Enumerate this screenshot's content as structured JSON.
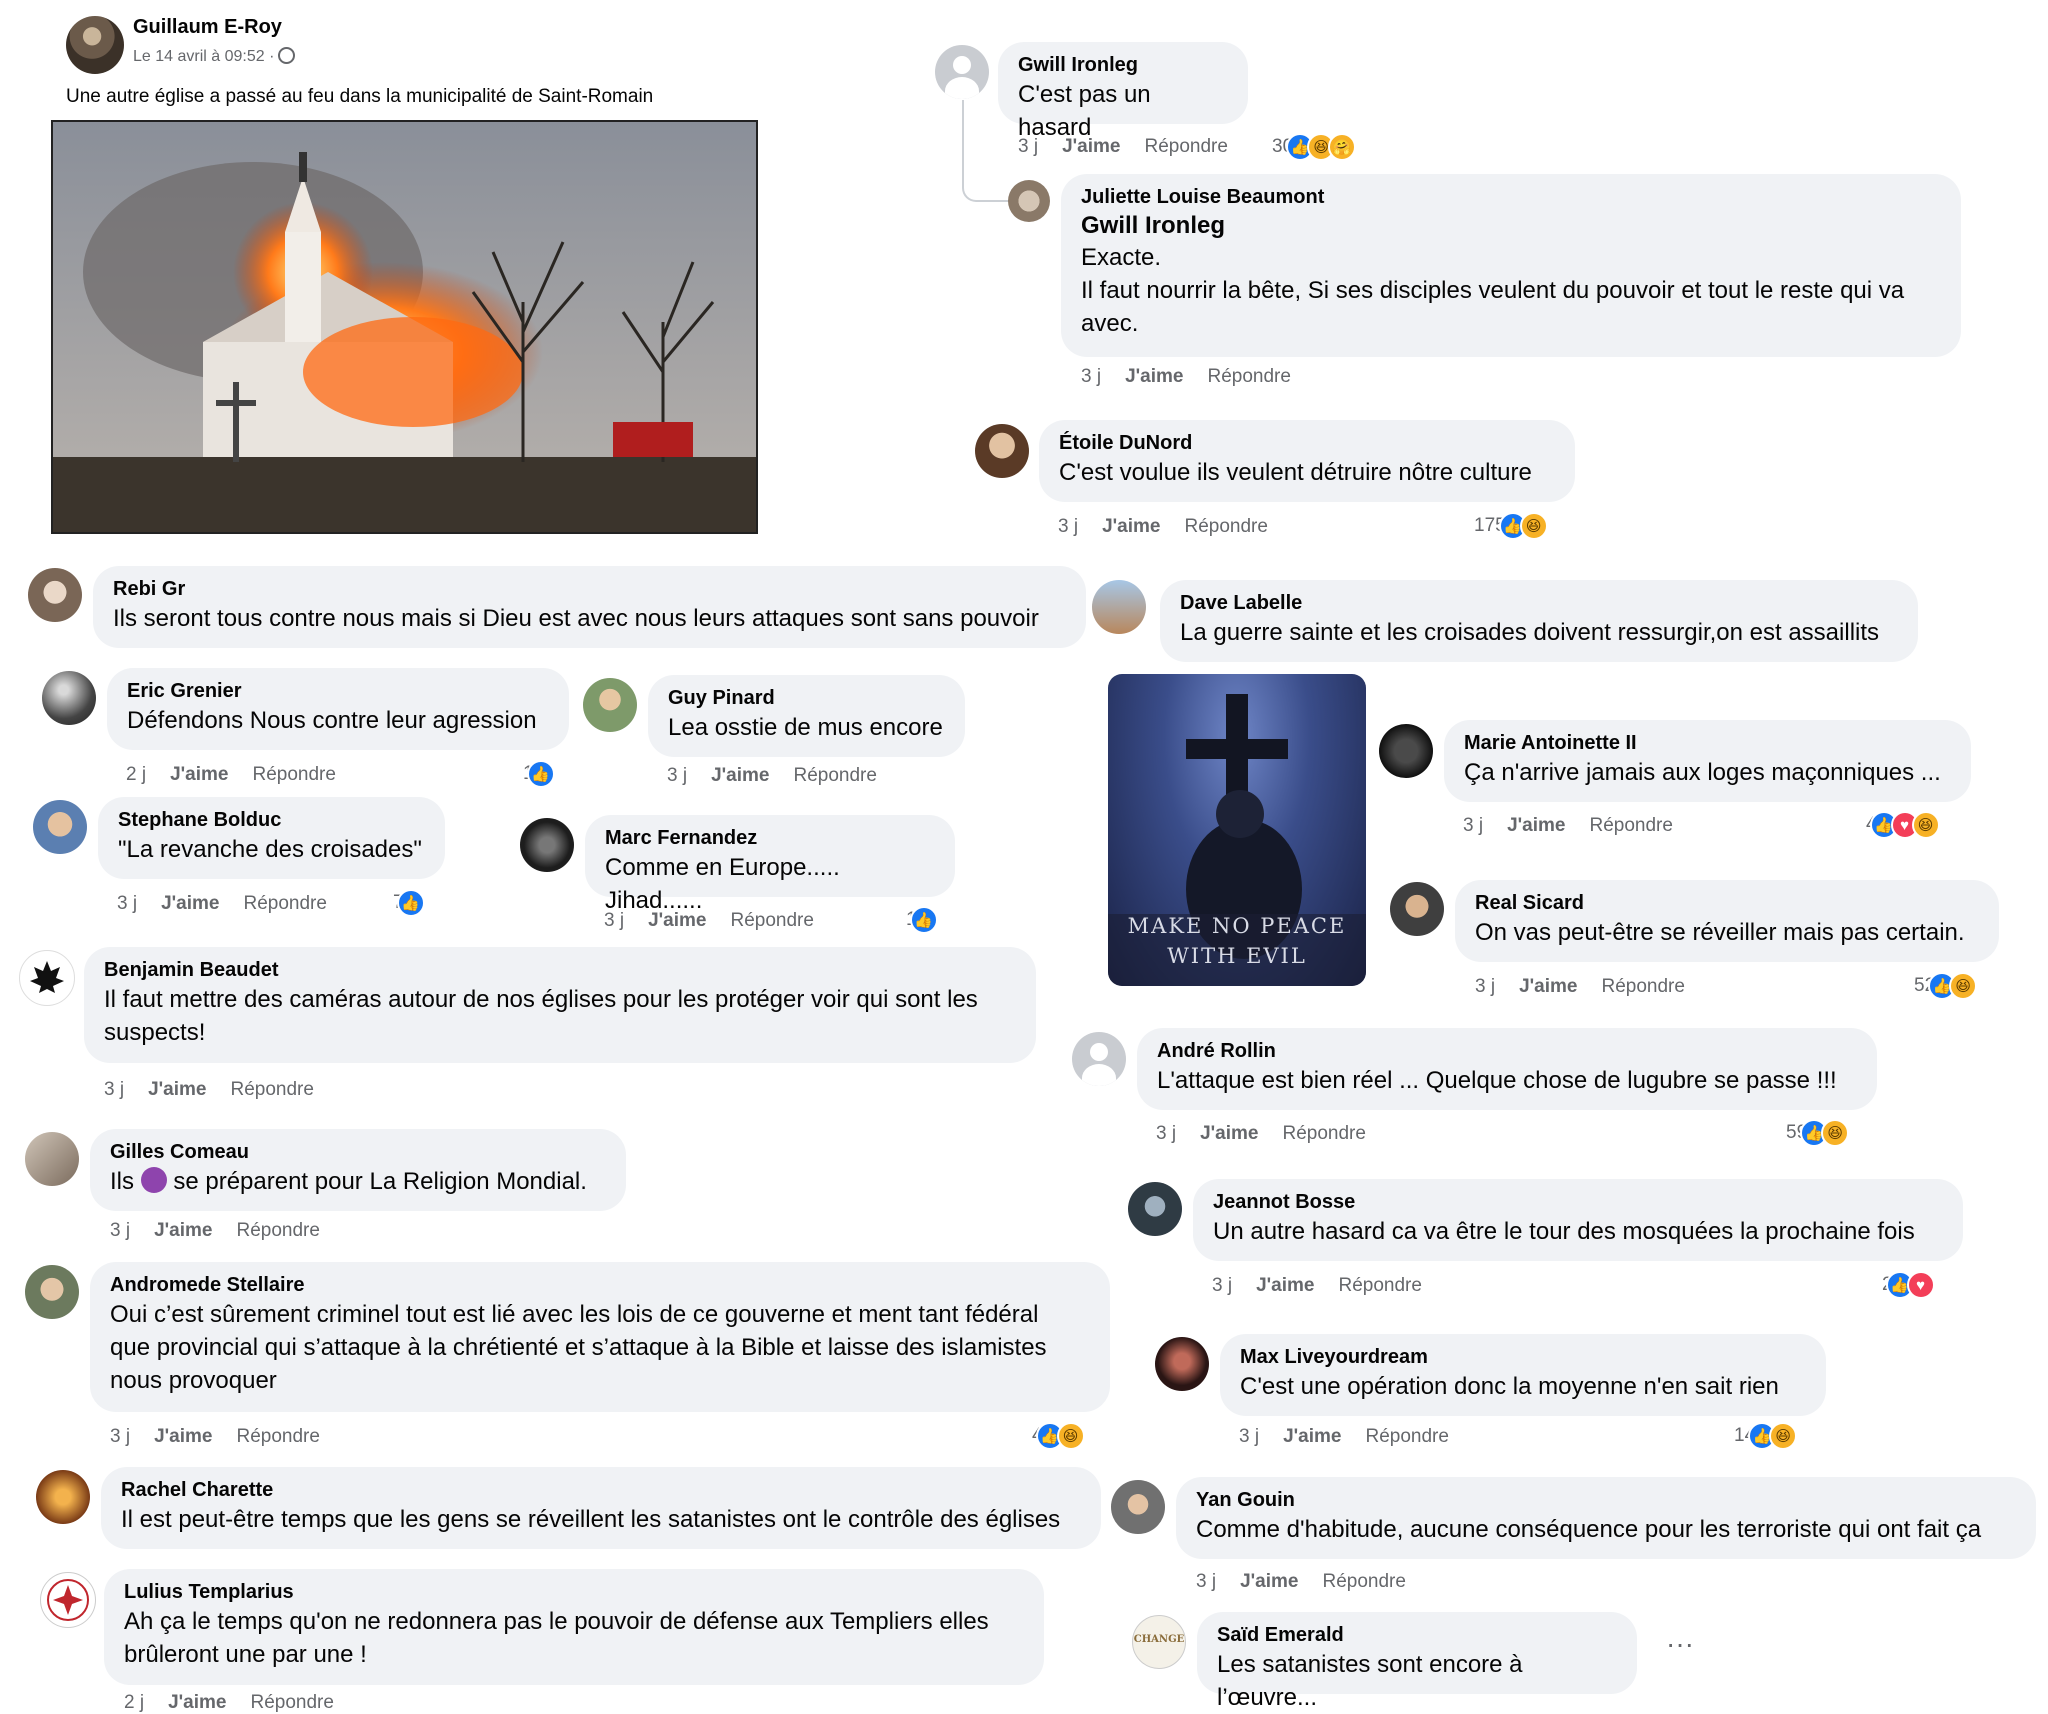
{
  "post": {
    "author": "Guillaum E-Roy",
    "date": "Le 14 avril à 09:52 ·",
    "text": "Une autre église a passé au feu dans la municipalité de Saint-Romain"
  },
  "actions": {
    "like": "J'aime",
    "reply": "Répondre"
  },
  "comments": [
    {
      "id": "gwill",
      "name": "Gwill Ironleg",
      "text": "C'est pas un hasard",
      "time": "3 j",
      "count": "30"
    },
    {
      "id": "juliette",
      "name": "Juliette Louise Beaumont",
      "mention": "Gwill Ironleg",
      "line1": "Exacte.",
      "line2": "Il faut nourrir la bête, Si ses disciples veulent du pouvoir et tout le reste qui va",
      "line3": "avec.",
      "time": "3 j"
    },
    {
      "id": "etoile",
      "name": "Étoile DuNord",
      "text": "C'est voulue ils veulent détruire nôtre culture",
      "time": "3 j",
      "count": "175"
    },
    {
      "id": "rebi",
      "name": "Rebi Gr",
      "text": "Ils seront tous contre nous mais si Dieu est avec nous leurs attaques sont sans pouvoir"
    },
    {
      "id": "dave",
      "name": "Dave Labelle",
      "text": "La guerre sainte et les croisades doivent ressurgir,on est assaillits"
    },
    {
      "id": "eric",
      "name": "Eric Grenier",
      "text": "Défendons Nous contre leur agression",
      "time": "2 j",
      "count": "1"
    },
    {
      "id": "guy",
      "name": "Guy Pinard",
      "text": "Lea osstie de mus encore",
      "time": "3 j"
    },
    {
      "id": "marie",
      "name": "Marie Antoinette II",
      "text": "Ça n'arrive jamais aux loges maçonniques ...",
      "time": "3 j",
      "count": "4"
    },
    {
      "id": "stephane",
      "name": "Stephane Bolduc",
      "text": "\"La revanche des croisades\"",
      "time": "3 j",
      "count": "7"
    },
    {
      "id": "marc",
      "name": "Marc Fernandez",
      "text": "Comme en Europe..... Jihad......",
      "time": "3 j",
      "count": "1"
    },
    {
      "id": "real",
      "name": "Real Sicard",
      "text": "On vas peut-être se réveiller mais pas certain.",
      "time": "3 j",
      "count": "52"
    },
    {
      "id": "benjamin",
      "name": "Benjamin Beaudet",
      "line1": "Il faut mettre des caméras autour de nos églises pour les protéger voir qui sont les",
      "line2": "suspects!",
      "time": "3 j"
    },
    {
      "id": "andre",
      "name": "André Rollin",
      "text": "L'attaque est bien réel ... Quelque chose de lugubre se passe !!!",
      "time": "3 j",
      "count": "59"
    },
    {
      "id": "gilles",
      "name": "Gilles Comeau",
      "text_a": "Ils",
      "text_b": "se préparent pour La Religion Mondial.",
      "time": "3 j"
    },
    {
      "id": "jeannot",
      "name": "Jeannot Bosse",
      "text": "Un autre hasard ca va être le tour des mosquées la prochaine fois",
      "time": "3 j",
      "count": "2"
    },
    {
      "id": "andromede",
      "name": "Andromede Stellaire",
      "line1": "Oui c’est sûrement criminel tout est lié avec les lois de ce gouverne et ment tant fédéral",
      "line2": "que provincial qui s’attaque à la chrétienté et s’attaque à la Bible et laisse des islamistes",
      "line3": "nous provoquer",
      "time": "3 j",
      "count": "4"
    },
    {
      "id": "max",
      "name": "Max Liveyourdream",
      "text": "C'est une opération donc la moyenne n'en sait rien",
      "time": "3 j",
      "count": "14"
    },
    {
      "id": "rachel",
      "name": "Rachel Charette",
      "text": "Il est peut-être temps que les gens se réveillent les satanistes ont le contrôle des églises"
    },
    {
      "id": "yan",
      "name": "Yan Gouin",
      "text": "Comme d'habitude, aucune conséquence pour les terroriste qui ont fait ça",
      "time": "3 j"
    },
    {
      "id": "lulius",
      "name": "Lulius Templarius",
      "line1": "Ah ça le temps qu'on ne redonnera pas le pouvoir de défense aux Templiers elles",
      "line2": "brûleront une par une !",
      "time": "2 j"
    },
    {
      "id": "said",
      "name": "Saïd Emerald",
      "text": "Les satanistes sont encore à l’œuvre..."
    }
  ],
  "image": {
    "caption_line1": "MAKE NO PEACE",
    "caption_line2": "WITH EVIL"
  },
  "avatar_text": {
    "said": "CHANGE"
  },
  "misc": {
    "ellipsis": "···"
  }
}
